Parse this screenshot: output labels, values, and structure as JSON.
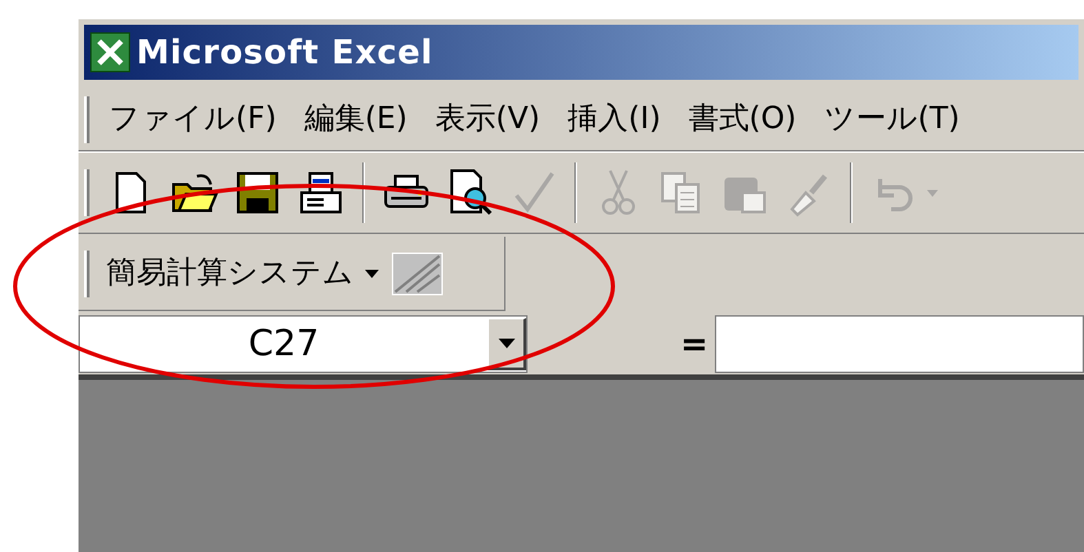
{
  "window": {
    "title": "Microsoft Excel"
  },
  "menu": [
    {
      "label": "ファイル(F)"
    },
    {
      "label": "編集(E)"
    },
    {
      "label": "表示(V)"
    },
    {
      "label": "挿入(I)"
    },
    {
      "label": "書式(O)"
    },
    {
      "label": "ツール(T)"
    }
  ],
  "toolbar": [
    {
      "kind": "new",
      "disabled": false
    },
    {
      "kind": "open",
      "disabled": false
    },
    {
      "kind": "save",
      "disabled": false
    },
    {
      "kind": "mail",
      "disabled": false
    },
    {
      "kind": "sep"
    },
    {
      "kind": "print",
      "disabled": false
    },
    {
      "kind": "preview",
      "disabled": false
    },
    {
      "kind": "spell",
      "disabled": true
    },
    {
      "kind": "sep"
    },
    {
      "kind": "cut",
      "disabled": true
    },
    {
      "kind": "copy",
      "disabled": true
    },
    {
      "kind": "paste",
      "disabled": true
    },
    {
      "kind": "brush",
      "disabled": true
    },
    {
      "kind": "sep"
    },
    {
      "kind": "undo",
      "disabled": true
    }
  ],
  "custom_toolbar": {
    "menu_label": "簡易計算システム"
  },
  "formula_bar": {
    "name_box": "C27",
    "equals": "="
  },
  "annotation": {
    "kind": "ellipse"
  }
}
